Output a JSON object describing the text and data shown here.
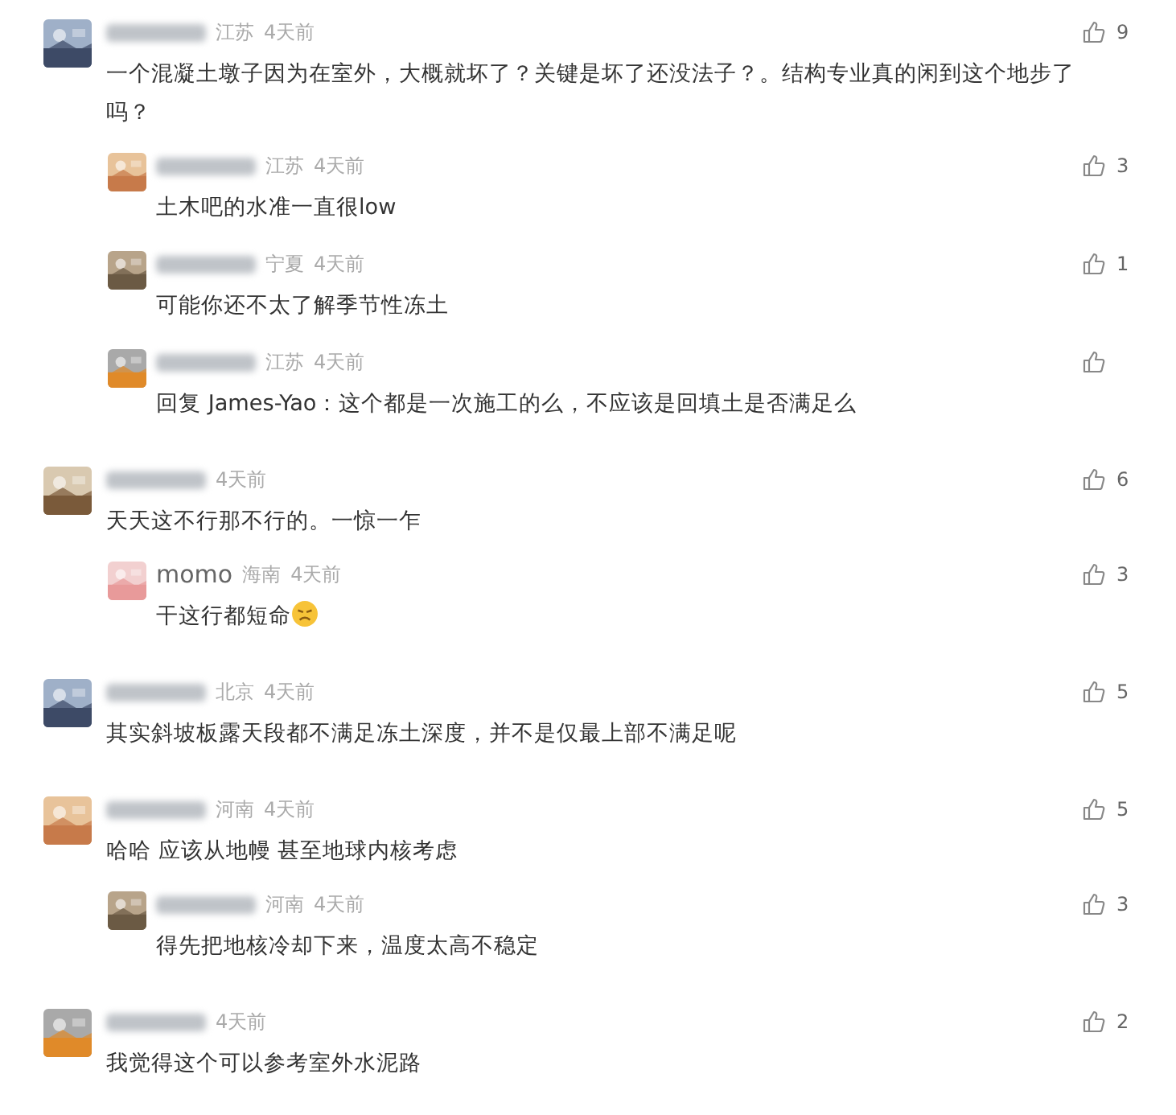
{
  "comments": [
    {
      "location": "江苏",
      "time": "4天前",
      "text": "一个混凝土墩子因为在室外，大概就坏了？关键是坏了还没法子？。结构专业真的闲到这个地步了吗？",
      "likes": "9",
      "replies": [
        {
          "location": "江苏",
          "time": "4天前",
          "text": "土木吧的水准一直很low",
          "likes": "3"
        },
        {
          "location": "宁夏",
          "time": "4天前",
          "text": "可能你还不太了解季节性冻土",
          "likes": "1"
        },
        {
          "location": "江苏",
          "time": "4天前",
          "text": "回复 James-Yao：这个都是一次施工的么，不应该是回填土是否满足么"
        }
      ]
    },
    {
      "time": "4天前",
      "text": "天天这不行那不行的。一惊一乍",
      "likes": "6",
      "replies": [
        {
          "user": "momo",
          "location": "海南",
          "time": "4天前",
          "text": "干这行都短命",
          "emoji": true,
          "likes": "3"
        }
      ]
    },
    {
      "location": "北京",
      "time": "4天前",
      "text": "其实斜坡板露天段都不满足冻土深度，并不是仅最上部不满足呢",
      "likes": "5"
    },
    {
      "location": "河南",
      "time": "4天前",
      "text": "哈哈 应该从地幔 甚至地球内核考虑",
      "likes": "5",
      "replies": [
        {
          "location": "河南",
          "time": "4天前",
          "text": "得先把地核冷却下来，温度太高不稳定",
          "likes": "3"
        }
      ]
    },
    {
      "time": "4天前",
      "text": "我觉得这个可以参考室外水泥路",
      "likes": "2"
    }
  ]
}
